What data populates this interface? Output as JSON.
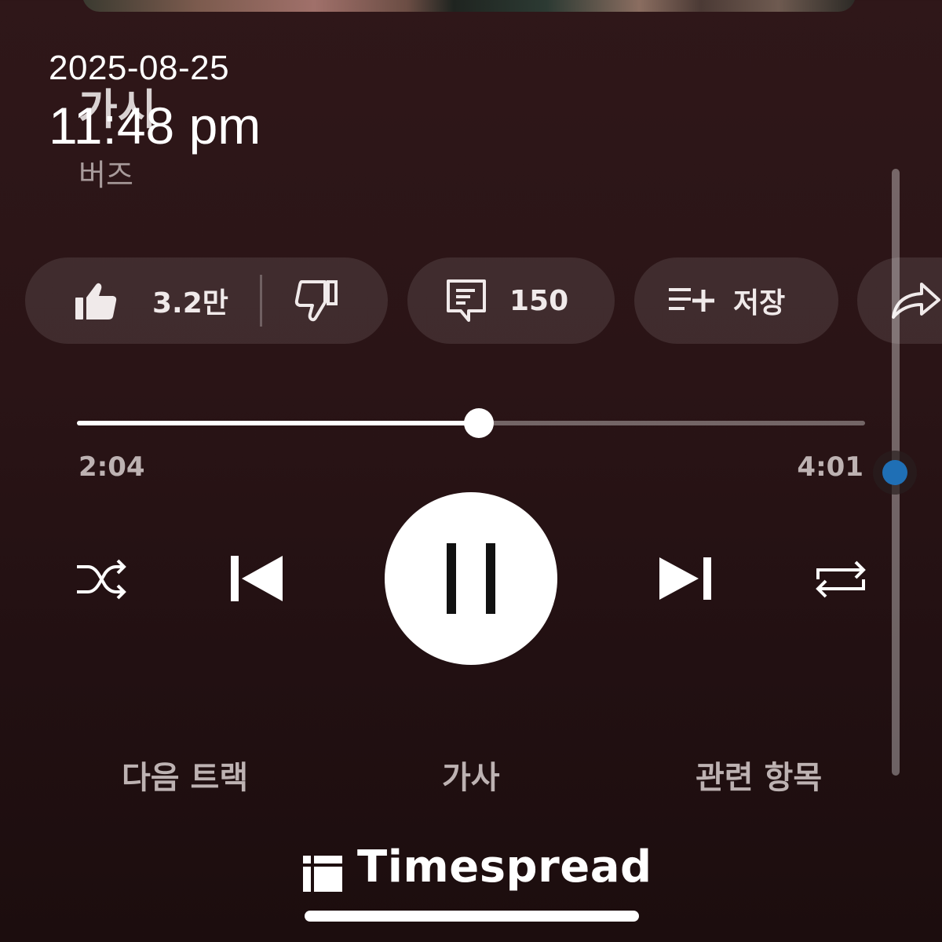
{
  "overlay": {
    "date": "2025-08-25",
    "time": "11:48 pm"
  },
  "song": {
    "title": "가시",
    "artist": "버즈"
  },
  "actions": {
    "like_count": "3.2만",
    "comment_count": "150",
    "save_label": "저장"
  },
  "progress": {
    "elapsed": "2:04",
    "total": "4:01",
    "fraction": 0.51
  },
  "tabs": {
    "up_next": "다음 트랙",
    "lyrics": "가사",
    "related": "관련 항목"
  },
  "watermark": {
    "brand": "Timespread"
  },
  "icons": {
    "like": "thumbs-up-icon",
    "dislike": "thumbs-down-icon",
    "comment": "comment-icon",
    "save": "playlist-add-icon",
    "share": "share-icon",
    "shuffle": "shuffle-icon",
    "previous": "skip-previous-icon",
    "pause": "pause-icon",
    "next": "skip-next-icon",
    "repeat": "repeat-icon"
  },
  "colors": {
    "background": "#2a1416",
    "accent": "#ffffff",
    "scroll_thumb": "#1f6fb5"
  }
}
